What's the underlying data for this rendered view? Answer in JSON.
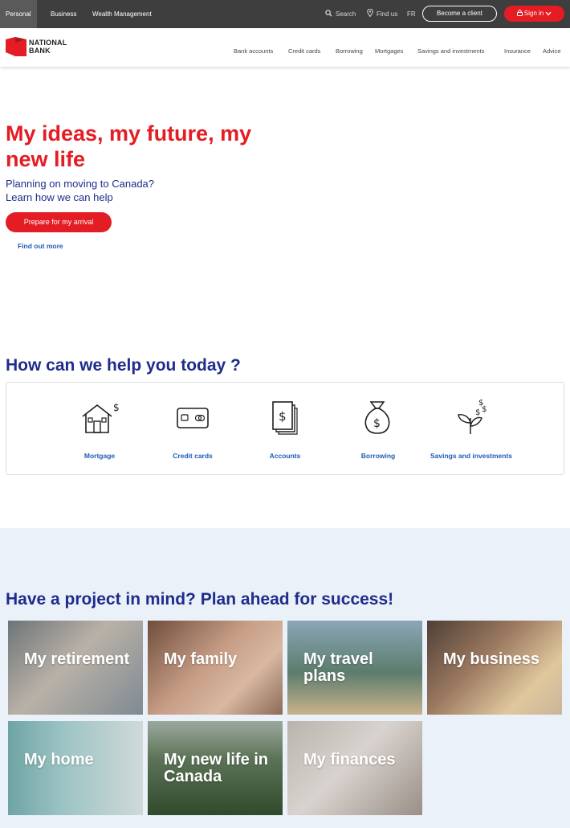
{
  "topbar": {
    "segments": [
      "Personal",
      "Business",
      "Wealth Management"
    ],
    "search_label": "Search",
    "find_label": "Find us",
    "lang_label": "FR",
    "become_client_label": "Become a client",
    "sign_in_label": "Sign in"
  },
  "header": {
    "logo_line1": "NATIONAL",
    "logo_line2": "BANK",
    "nav": [
      "Bank accounts",
      "Credit cards",
      "Borrowing",
      "Mortgages",
      "Savings and investments",
      "Insurance",
      "Advice"
    ]
  },
  "hero": {
    "title": "My ideas, my future, my new life",
    "subtitle_line1": "Planning on moving to Canada?",
    "subtitle_line2": "Learn how we can help",
    "cta_label": "Prepare for my arrival",
    "link_label": "Find out more"
  },
  "help": {
    "title": "How can we help you today ?",
    "items": [
      {
        "label": "Mortgage",
        "icon": "house-dollar-icon"
      },
      {
        "label": "Credit cards",
        "icon": "credit-card-icon"
      },
      {
        "label": "Accounts",
        "icon": "accounts-icon"
      },
      {
        "label": "Borrowing",
        "icon": "money-bag-icon"
      },
      {
        "label": "Savings and investments",
        "icon": "plant-dollar-icon"
      }
    ]
  },
  "projects": {
    "title": "Have a project in mind? Plan ahead for success!",
    "tiles": [
      {
        "label": "My retirement"
      },
      {
        "label": "My family"
      },
      {
        "label": "My travel plans"
      },
      {
        "label": "My business"
      },
      {
        "label": "My home"
      },
      {
        "label": "My new life in Canada"
      },
      {
        "label": "My finances"
      }
    ]
  },
  "colors": {
    "brand_red": "#e41c23",
    "navy": "#1f2c8c",
    "link_blue": "#1f5bb5",
    "topbar": "#3e3e3e",
    "projects_bg": "#eaf1f8"
  }
}
